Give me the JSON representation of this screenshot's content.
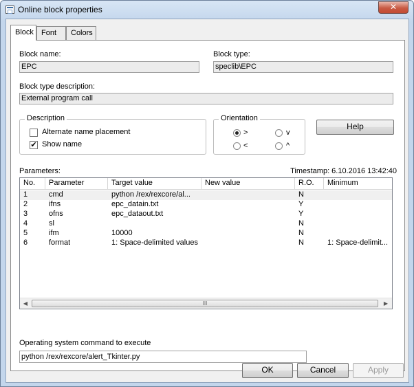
{
  "window": {
    "title": "Online block properties",
    "close_glyph": "✕"
  },
  "tabs": [
    {
      "label": "Block"
    },
    {
      "label": "Font"
    },
    {
      "label": "Colors"
    }
  ],
  "block": {
    "name_label": "Block name:",
    "name_value": "EPC",
    "type_label": "Block type:",
    "type_value": "speclib\\EPC",
    "desc_label": "Block type description:",
    "desc_value": "External program call"
  },
  "description_group": {
    "title": "Description",
    "alt_label": "Alternate name placement",
    "alt_checked": false,
    "show_label": "Show name",
    "show_checked": true,
    "check_glyph": "✔"
  },
  "orientation_group": {
    "title": "Orientation",
    "options": [
      ">",
      "v",
      "<",
      "^"
    ],
    "selected": ">"
  },
  "help_label": "Help",
  "parameters": {
    "label": "Parameters:",
    "timestamp": "Timestamp: 6.10.2016 13:42:40",
    "columns": [
      "No.",
      "Parameter",
      "Target value",
      "New value",
      "R.O.",
      "Minimum"
    ],
    "rows": [
      {
        "no": "1",
        "param": "cmd",
        "target": "python  /rex/rexcore/al...",
        "new": "",
        "ro": "N",
        "min": ""
      },
      {
        "no": "2",
        "param": "ifns",
        "target": "epc_datain.txt",
        "new": "",
        "ro": "Y",
        "min": ""
      },
      {
        "no": "3",
        "param": "ofns",
        "target": "epc_dataout.txt",
        "new": "",
        "ro": "Y",
        "min": ""
      },
      {
        "no": "4",
        "param": "sl",
        "target": "",
        "new": "",
        "ro": "N",
        "min": ""
      },
      {
        "no": "5",
        "param": "ifm",
        "target": "10000",
        "new": "",
        "ro": "N",
        "min": ""
      },
      {
        "no": "6",
        "param": "format",
        "target": "1: Space-delimited values",
        "new": "",
        "ro": "N",
        "min": "1: Space-delimit..."
      }
    ],
    "scroll_grip": "III",
    "arrow_left": "◀",
    "arrow_right": "▶"
  },
  "command": {
    "label": "Operating system command to execute",
    "value": "python  /rex/rexcore/alert_Tkinter.py"
  },
  "buttons": {
    "ok": "OK",
    "cancel": "Cancel",
    "apply": "Apply"
  }
}
